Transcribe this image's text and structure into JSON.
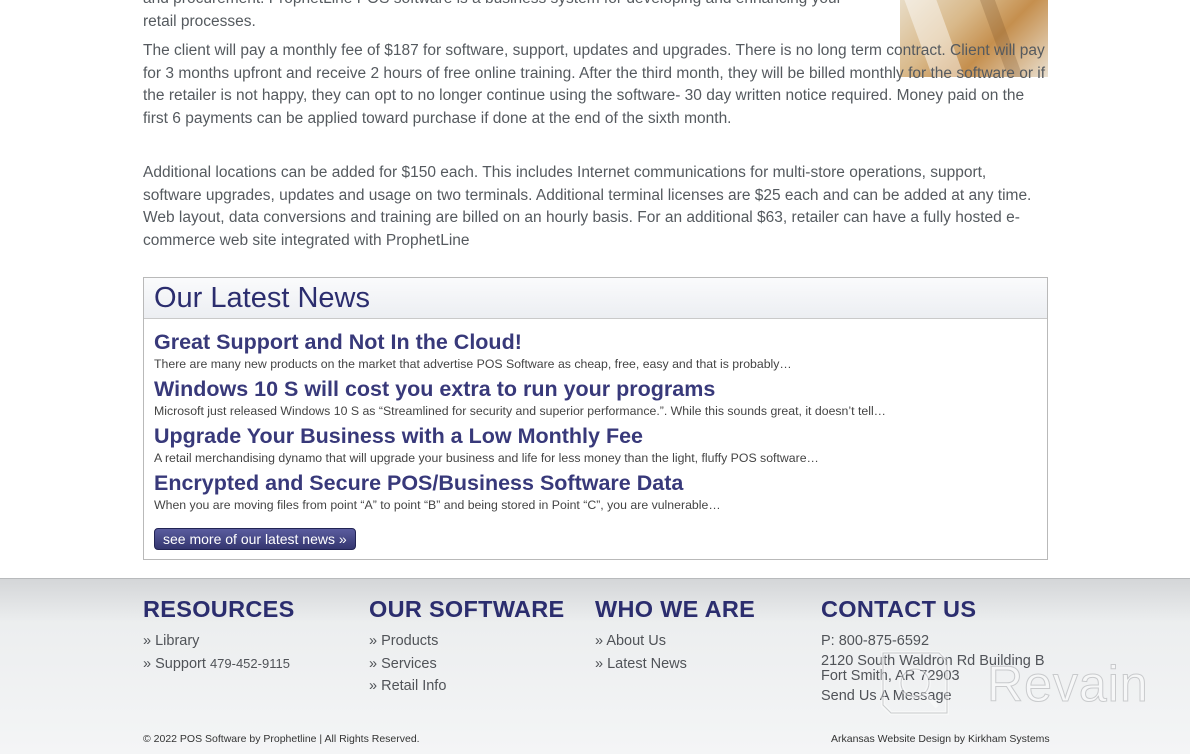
{
  "intro": {
    "p0": "and procurement. ProphetLine POS software is a business system for developing and enhancing your retail processes.",
    "p1": "The client will pay a monthly fee of $187 for software, support, updates and upgrades. There is no long term contract. Client will pay for 3 months upfront and receive 2 hours of free online training. After the third month, they will be billed monthly for the software or if the retailer is not happy, they can opt to no longer continue using the software- 30 day written notice required. Money paid on the first 6 payments can be applied toward purchase if done at the end of the sixth month.",
    "p2": "Additional locations can be added for $150 each. This includes Internet communications for multi-store operations, support, software upgrades, updates and usage on two terminals. Additional terminal licenses are $25 each and can be added at any time. Web layout, data conversions and training are billed on an hourly basis. For an additional $63, retailer can have a fully hosted e-commerce web site integrated with ProphetLine"
  },
  "news": {
    "title": "Our Latest News",
    "items": [
      {
        "title": "Great Support and Not In the Cloud!",
        "excerpt": "There are many new products on the market that advertise POS Software as cheap, free, easy and that is probably…"
      },
      {
        "title": "Windows 10 S will cost you extra to run your programs",
        "excerpt": "Microsoft just released Windows 10 S as “Streamlined for security and superior performance.”. While this sounds great, it doesn’t tell…"
      },
      {
        "title": "Upgrade Your Business with a Low Monthly Fee",
        "excerpt": "A retail merchandising dynamo that will upgrade your business and life for less money than the light, fluffy POS software…"
      },
      {
        "title": "Encrypted and Secure POS/Business Software Data",
        "excerpt": "When you are moving files from point “A” to point “B” and being stored in Point “C”, you are vulnerable…"
      }
    ],
    "more_label": "see more of our latest news »"
  },
  "footer": {
    "resources": {
      "heading": "RESOURCES",
      "links": [
        "Library",
        "Support"
      ],
      "support_phone": "479-452-9115"
    },
    "software": {
      "heading": "OUR SOFTWARE",
      "links": [
        "Products",
        "Services",
        "Retail Info"
      ]
    },
    "who": {
      "heading": "WHO WE ARE",
      "links": [
        "About Us",
        "Latest News"
      ]
    },
    "contact": {
      "heading": "CONTACT US",
      "phone": "P: 800-875-6592",
      "address1": "2120 South Waldron Rd Building B",
      "address2": "Fort Smith, AR 72903",
      "message_link": "Send Us A Message"
    },
    "bullet": "»",
    "copyright": "© 2022 POS Software by Prophetline | All Rights Reserved.",
    "credit_link": "Arkansas Website Design",
    "credit_by": "by",
    "credit_company": "Kirkham Systems"
  },
  "watermark": {
    "text": "Revain"
  },
  "icons": {
    "watermark_logo": "revain-logo-icon"
  }
}
